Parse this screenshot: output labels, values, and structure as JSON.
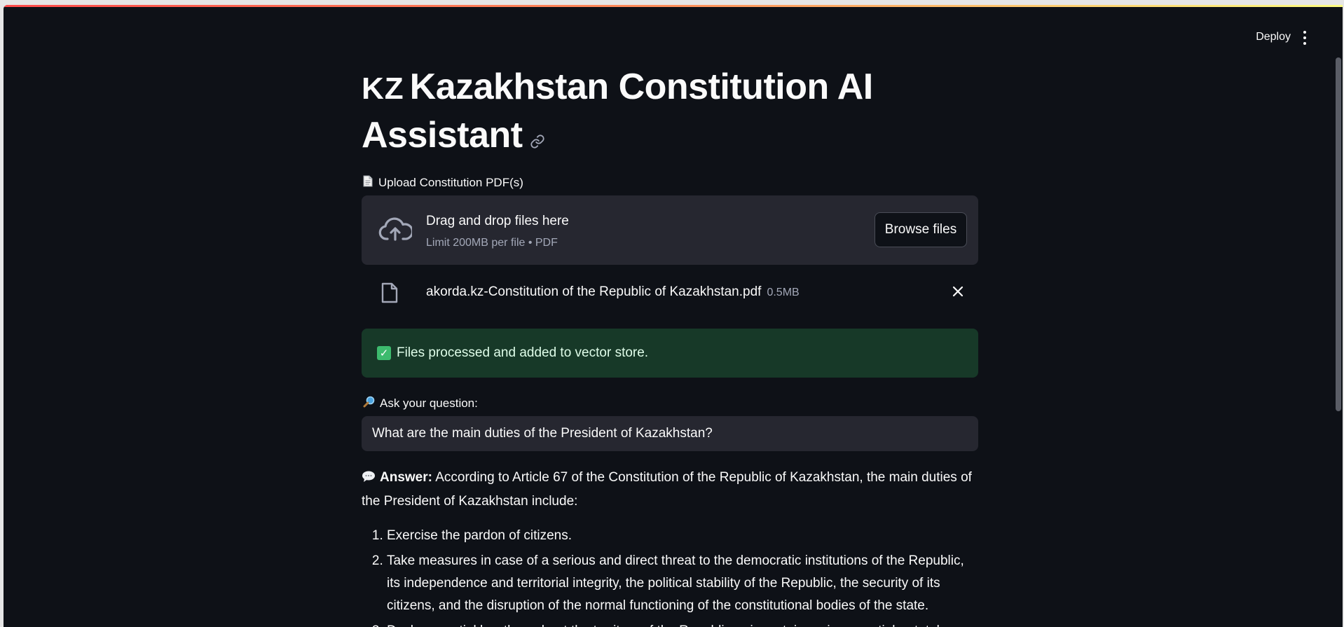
{
  "toolbar": {
    "deploy_label": "Deploy"
  },
  "header": {
    "flag": "KZ",
    "title": "Kazakhstan Constitution AI Assistant"
  },
  "uploader": {
    "label": "Upload Constitution PDF(s)",
    "drop_title": "Drag and drop files here",
    "drop_sub": "Limit 200MB per file • PDF",
    "browse_label": "Browse files",
    "file_name": "akorda.kz-Constitution of the Republic of Kazakhstan.pdf",
    "file_size": "0.5MB"
  },
  "status": {
    "icon": "✓",
    "message": "Files processed and added to vector store."
  },
  "question": {
    "label": "Ask your question:",
    "value": "What are the main duties of the President of Kazakhstan?"
  },
  "answer": {
    "prefix": "Answer:",
    "intro": "According to Article 67 of the Constitution of the Republic of Kazakhstan, the main duties of the President of Kazakhstan include:",
    "items": [
      "Exercise the pardon of citizens.",
      "Take measures in case of a serious and direct threat to the democratic institutions of the Republic, its independence and territorial integrity, the political stability of the Republic, the security of its citizens, and the disruption of the normal functioning of the constitutional bodies of the state.",
      "Declare martial law throughout the territory of the Republic or in certain regions, partial or total"
    ]
  },
  "colors": {
    "background": "#0e1117",
    "surface": "#262730",
    "success_bg": "#173928",
    "text": "#fafafa",
    "muted": "#a3a8b8"
  },
  "icons": [
    "link-icon",
    "document-icon",
    "cloud-upload-icon",
    "file-icon",
    "close-icon",
    "check-icon",
    "magnifier-icon",
    "speech-bubble-icon",
    "kebab-menu-icon"
  ]
}
